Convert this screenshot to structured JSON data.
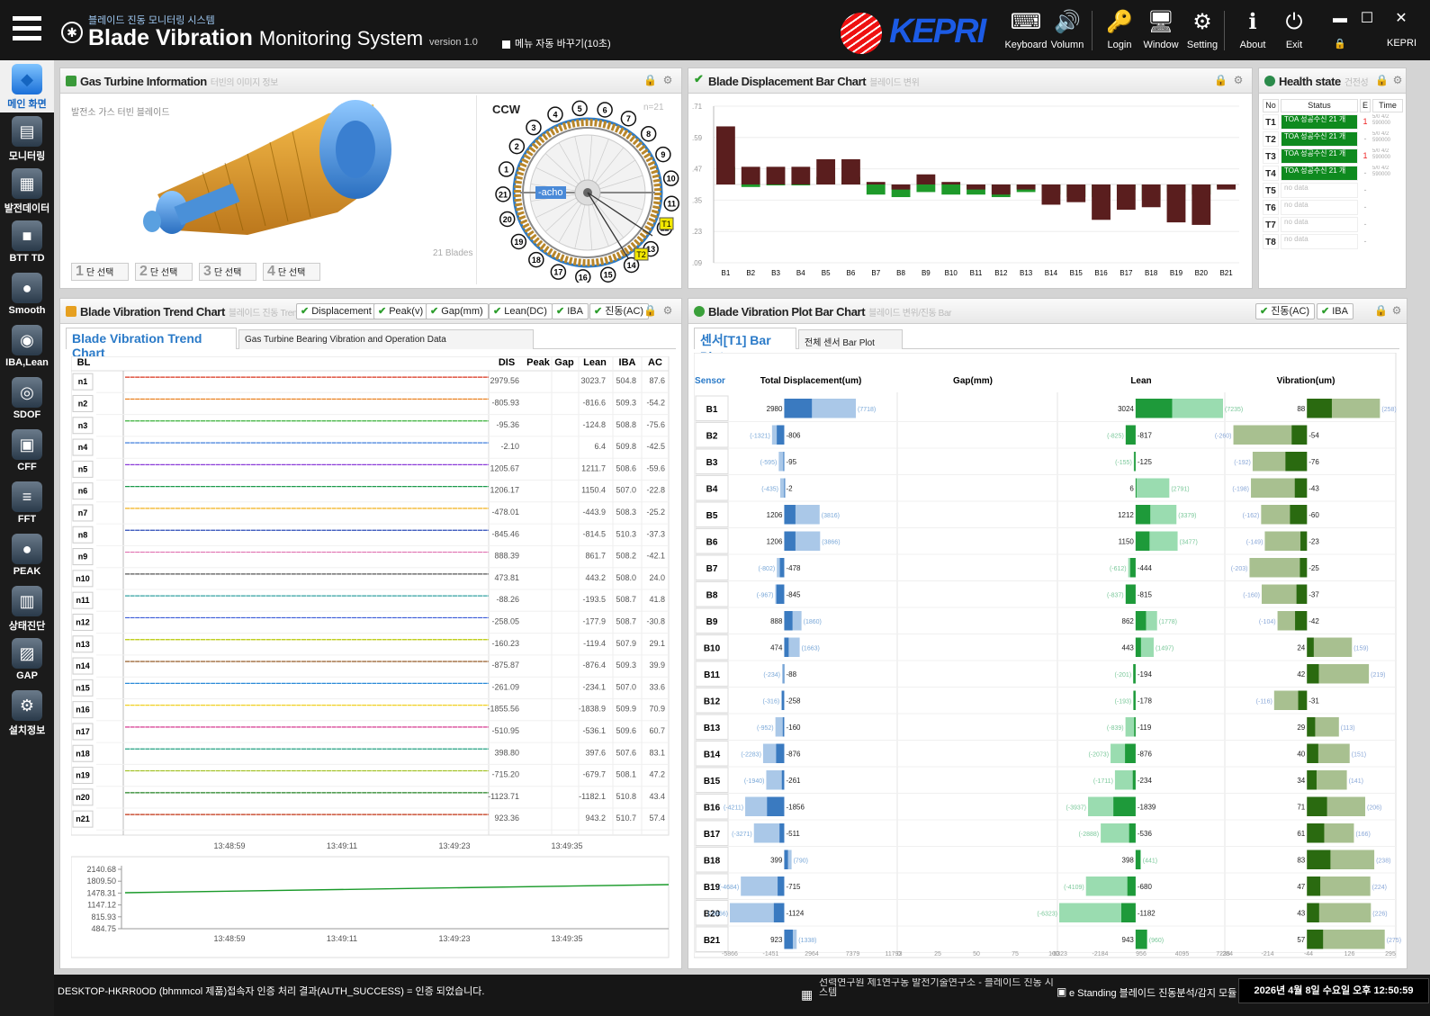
{
  "title": {
    "kr": "블레이드 진동 모니터링 시스템",
    "main": "Blade Vibration",
    "sub": "Monitoring System",
    "version": "version 1.0",
    "auto_menu": "메뉴 자동 바꾸기(10초)",
    "logo": "KEPRI"
  },
  "toolbar": [
    {
      "label": "Keyboard",
      "icon": "keyboard-icon",
      "glyph": "⌨"
    },
    {
      "label": "Volumn",
      "icon": "speaker-icon",
      "glyph": "🔊"
    },
    {
      "label": "Login",
      "icon": "key-icon",
      "glyph": "🔑"
    },
    {
      "label": "Window",
      "icon": "monitor-icon",
      "glyph": "🖥"
    },
    {
      "label": "Setting",
      "icon": "gear-icon",
      "glyph": "⚙"
    },
    {
      "label": "About",
      "icon": "info-icon",
      "glyph": "ℹ"
    },
    {
      "label": "Exit",
      "icon": "power-icon",
      "glyph": "⏻"
    }
  ],
  "user": {
    "name": "KEPRI"
  },
  "sidebar": [
    {
      "label": "메인 화면",
      "icon": "main-screen-icon",
      "glyph": "◆",
      "active": true
    },
    {
      "label": "모니터링",
      "icon": "monitoring-icon",
      "glyph": "▤"
    },
    {
      "label": "발전데이터",
      "icon": "power-data-icon",
      "glyph": "▦"
    },
    {
      "label": "BTT TD",
      "icon": "btt-td-icon",
      "glyph": "■"
    },
    {
      "label": "Smooth",
      "icon": "smooth-icon",
      "glyph": "●"
    },
    {
      "label": "IBA,Lean",
      "icon": "iba-lean-icon",
      "glyph": "◉"
    },
    {
      "label": "SDOF",
      "icon": "sdof-icon",
      "glyph": "◎"
    },
    {
      "label": "CFF",
      "icon": "cff-icon",
      "glyph": "▣"
    },
    {
      "label": "FFT",
      "icon": "fft-icon",
      "glyph": "≡"
    },
    {
      "label": "PEAK",
      "icon": "peak-icon",
      "glyph": "●"
    },
    {
      "label": "상태진단",
      "icon": "diagnosis-icon",
      "glyph": "▥"
    },
    {
      "label": "GAP",
      "icon": "gap-icon",
      "glyph": "▨"
    },
    {
      "label": "설치정보",
      "icon": "install-info-icon",
      "glyph": "⚙"
    }
  ],
  "gas_turbine": {
    "title": "Gas Turbine Information",
    "subtitle": "터빈의 이미지 정보",
    "caption": "발전소 가스 터빈 블레이드",
    "blades_label": "21 Blades",
    "direction": "CCW",
    "n_label": "n=21",
    "tacho": "-acho",
    "stages": [
      {
        "num": "1",
        "label": "단 선택"
      },
      {
        "num": "2",
        "label": "단 선택"
      },
      {
        "num": "3",
        "label": "단 선택"
      },
      {
        "num": "4",
        "label": "단 선택"
      }
    ],
    "sensors": [
      "T1",
      "T2"
    ]
  },
  "bar_chart": {
    "title": "Blade Displacement Bar Chart",
    "subtitle": "블레이드 변위"
  },
  "health": {
    "title": "Health state",
    "subtitle": "건전성",
    "headers": {
      "no": "No",
      "status": "Status",
      "e": "E",
      "time": "Time"
    },
    "rows": [
      {
        "no": "T1",
        "status": "TOA 성공수신 21 개",
        "e": "1",
        "time": "5/0 4/2 590000",
        "ok": true
      },
      {
        "no": "T2",
        "status": "TOA 성공수신 21 개",
        "e": "-",
        "time": "5/0 4/2 590000",
        "ok": true
      },
      {
        "no": "T3",
        "status": "TOA 성공수신 21 개",
        "e": "1",
        "time": "5/0 4/2 590000",
        "ok": true
      },
      {
        "no": "T4",
        "status": "TOA 성공수신 21 개",
        "e": "-",
        "time": "5/0 4/2 590000",
        "ok": true
      },
      {
        "no": "T5",
        "status": "no data",
        "e": "-",
        "time": "",
        "ok": false
      },
      {
        "no": "T6",
        "status": "no data",
        "e": "-",
        "time": "",
        "ok": false
      },
      {
        "no": "T7",
        "status": "no data",
        "e": "-",
        "time": "",
        "ok": false
      },
      {
        "no": "T8",
        "status": "no data",
        "e": "-",
        "time": "",
        "ok": false
      }
    ]
  },
  "trend": {
    "title": "Blade Vibration Trend Chart",
    "subtitle": "블레이드 진동 Trend",
    "chips": [
      "Displacement",
      "Peak(v)",
      "Gap(mm)",
      "Lean(DC)",
      "IBA",
      "진동(AC)"
    ],
    "tab_active": "Blade Vibration Trend Chart",
    "tab_other": "Gas Turbine Bearing Vibration and Operation Data",
    "headers": {
      "bl": "BL",
      "dis": "DIS",
      "peak": "Peak",
      "gap": "Gap",
      "lean": "Lean",
      "iba": "IBA",
      "ac": "AC"
    },
    "x_ticks": [
      "13:48:59",
      "13:49:11",
      "13:49:23",
      "13:49:35"
    ],
    "lower_y_ticks": [
      "2140.68",
      "1809.50",
      "1478.31",
      "1147.12",
      "815.93",
      "484.75"
    ]
  },
  "plot_bar": {
    "title": "Blade Vibration Plot Bar Chart",
    "subtitle": "블레이드 변위/진동 Bar",
    "chips": [
      "진동(AC)",
      "IBA"
    ],
    "tab_active": "센서[T1] Bar Plot",
    "tab_other": "전체 센서 Bar Plot",
    "headers": {
      "sensor": "Sensor",
      "total": "Total Displacement(um)",
      "gap": "Gap(mm)",
      "lean": "Lean",
      "vib": "Vibration(um)"
    },
    "bottom_ticks": {
      "total": [
        "-5866",
        "-1451",
        "2964",
        "7379",
        "11793"
      ],
      "gap": [
        "0",
        "25",
        "50",
        "75",
        "100"
      ],
      "lean": [
        "-6323",
        "-2184",
        "956",
        "4095",
        "7235"
      ],
      "vib": [
        "-284",
        "-214",
        "-44",
        "126",
        "295"
      ]
    }
  },
  "chart_data": {
    "type": "table",
    "blades": [
      {
        "bl": "n1",
        "dis": "2979.56",
        "lean": "3023.7",
        "iba": "504.8",
        "ac": "87.6"
      },
      {
        "bl": "n2",
        "dis": "-805.93",
        "lean": "-816.6",
        "iba": "509.3",
        "ac": "-54.2"
      },
      {
        "bl": "n3",
        "dis": "-95.36",
        "lean": "-124.8",
        "iba": "508.8",
        "ac": "-75.6"
      },
      {
        "bl": "n4",
        "dis": "-2.10",
        "lean": "6.4",
        "iba": "509.8",
        "ac": "-42.5"
      },
      {
        "bl": "n5",
        "dis": "1205.67",
        "lean": "1211.7",
        "iba": "508.6",
        "ac": "-59.6"
      },
      {
        "bl": "n6",
        "dis": "1206.17",
        "lean": "1150.4",
        "iba": "507.0",
        "ac": "-22.8"
      },
      {
        "bl": "n7",
        "dis": "-478.01",
        "lean": "-443.9",
        "iba": "508.3",
        "ac": "-25.2"
      },
      {
        "bl": "n8",
        "dis": "-845.46",
        "lean": "-814.5",
        "iba": "510.3",
        "ac": "-37.3"
      },
      {
        "bl": "n9",
        "dis": "888.39",
        "lean": "861.7",
        "iba": "508.2",
        "ac": "-42.1"
      },
      {
        "bl": "n10",
        "dis": "473.81",
        "lean": "443.2",
        "iba": "508.0",
        "ac": "24.0"
      },
      {
        "bl": "n11",
        "dis": "-88.26",
        "lean": "-193.5",
        "iba": "508.7",
        "ac": "41.8"
      },
      {
        "bl": "n12",
        "dis": "-258.05",
        "lean": "-177.9",
        "iba": "508.7",
        "ac": "-30.8"
      },
      {
        "bl": "n13",
        "dis": "-160.23",
        "lean": "-119.4",
        "iba": "507.9",
        "ac": "29.1"
      },
      {
        "bl": "n14",
        "dis": "-875.87",
        "lean": "-876.4",
        "iba": "509.3",
        "ac": "39.9"
      },
      {
        "bl": "n15",
        "dis": "-261.09",
        "lean": "-234.1",
        "iba": "507.0",
        "ac": "33.6"
      },
      {
        "bl": "n16",
        "dis": "-1855.56",
        "lean": "-1838.9",
        "iba": "509.9",
        "ac": "70.9"
      },
      {
        "bl": "n17",
        "dis": "-510.95",
        "lean": "-536.1",
        "iba": "509.6",
        "ac": "60.7"
      },
      {
        "bl": "n18",
        "dis": "398.80",
        "lean": "397.6",
        "iba": "507.6",
        "ac": "83.1"
      },
      {
        "bl": "n19",
        "dis": "-715.20",
        "lean": "-679.7",
        "iba": "508.1",
        "ac": "47.2"
      },
      {
        "bl": "n20",
        "dis": "-1123.71",
        "lean": "-1182.1",
        "iba": "510.8",
        "ac": "43.4"
      },
      {
        "bl": "n21",
        "dis": "923.36",
        "lean": "943.2",
        "iba": "510.7",
        "ac": "57.4"
      }
    ],
    "bar_chart": {
      "type": "bar",
      "categories": [
        "B1",
        "B2",
        "B3",
        "B4",
        "B5",
        "B6",
        "B7",
        "B8",
        "B9",
        "B10",
        "B11",
        "B12",
        "B13",
        "B14",
        "B15",
        "B16",
        "B17",
        "B18",
        "B19",
        "B20",
        "B21"
      ],
      "y_ticks": [
        ".71",
        ".59",
        ".47",
        ".35",
        ".23",
        ".09"
      ],
      "ylim": [
        0.09,
        0.71
      ],
      "series": [
        {
          "color": "#1e9a2a",
          "values": [
            0.47,
            0.39,
            0.4,
            0.4,
            0.43,
            0.43,
            0.36,
            0.35,
            0.37,
            0.36,
            0.36,
            0.35,
            0.37,
            0.36,
            0.35,
            0.35,
            0.38,
            0.34,
            0.37,
            0.36,
            0.39
          ]
        },
        {
          "color": "#5a1e1e",
          "values": [
            0.63,
            0.47,
            0.47,
            0.47,
            0.5,
            0.5,
            0.41,
            0.38,
            0.44,
            0.41,
            0.38,
            0.36,
            0.38,
            0.32,
            0.33,
            0.26,
            0.3,
            0.31,
            0.25,
            0.24,
            0.38
          ]
        }
      ]
    },
    "bar_plot": {
      "sensors": [
        "B1",
        "B2",
        "B3",
        "B4",
        "B5",
        "B6",
        "B7",
        "B8",
        "B9",
        "B10",
        "B11",
        "B12",
        "B13",
        "B14",
        "B15",
        "B16",
        "B17",
        "B18",
        "B19",
        "B20",
        "B21"
      ],
      "total_value": [
        2980,
        -806,
        -95,
        -2,
        1206,
        1206,
        -478,
        -845,
        888,
        474,
        -88,
        -258,
        -160,
        -876,
        -261,
        -1856,
        -511,
        399,
        -715,
        -1124,
        923
      ],
      "total_label": [
        "2980",
        "-806",
        "-95",
        "-2",
        "1206",
        "1206",
        "-478",
        "-845",
        "888",
        "474",
        "-88",
        "-258",
        "-160",
        "-876",
        "-261",
        "-1856",
        "-511",
        "399",
        "-715",
        "-1124",
        "923"
      ],
      "total_ref": [
        "(7718)",
        "(-1321)",
        "(-595)",
        "(-435)",
        "(3816)",
        "(3866)",
        "(-802)",
        "(-967)",
        "(1860)",
        "(1663)",
        "(-234)",
        "(-316)",
        "(-952)",
        "(-2283)",
        "(-1940)",
        "(-4211)",
        "(-3271)",
        "(790)",
        "(-4684)",
        "(-5866)",
        "(1338)"
      ],
      "total_ref_value": [
        7718,
        -1321,
        -595,
        -435,
        3816,
        3866,
        -802,
        -967,
        1860,
        1663,
        -234,
        -316,
        -952,
        -2283,
        -1940,
        -4211,
        -3271,
        790,
        -4684,
        -5866,
        1338
      ],
      "total_range": [
        -5866,
        11793
      ],
      "lean_value": [
        3024,
        -817,
        -125,
        6,
        1212,
        1150,
        -444,
        -815,
        862,
        443,
        -194,
        -178,
        -119,
        -876,
        -234,
        -1839,
        -536,
        398,
        -680,
        -1182,
        943
      ],
      "lean_label": [
        "3024",
        "-817",
        "-125",
        "6",
        "1212",
        "1150",
        "-444",
        "-815",
        "862",
        "443",
        "-194",
        "-178",
        "-119",
        "-876",
        "-234",
        "-1839",
        "-536",
        "398",
        "-680",
        "-1182",
        "943"
      ],
      "lean_ref": [
        "(7235)",
        "(-825)",
        "(-155)",
        "(2791)",
        "(3379)",
        "(3477)",
        "(-612)",
        "(-837)",
        "(1778)",
        "(1497)",
        "(-201)",
        "(-193)",
        "(-839)",
        "(-2073)",
        "(-1711)",
        "(-3937)",
        "(-2888)",
        "(441)",
        "(-4109)",
        "(-6323)",
        "(960)"
      ],
      "lean_ref_value": [
        7235,
        -825,
        -155,
        2791,
        3379,
        3477,
        -612,
        -837,
        1778,
        1497,
        -201,
        -193,
        -839,
        -2073,
        -1711,
        -3937,
        -2888,
        441,
        -4109,
        -6323,
        960
      ],
      "lean_range": [
        -6323,
        7235
      ],
      "vib_value": [
        88,
        -54,
        -76,
        -43,
        -60,
        -23,
        -25,
        -37,
        -42,
        24,
        42,
        -31,
        29,
        40,
        34,
        71,
        61,
        83,
        47,
        43,
        57
      ],
      "vib_label": [
        "88",
        "-54",
        "-76",
        "-43",
        "-60",
        "-23",
        "-25",
        "-37",
        "-42",
        "24",
        "42",
        "-31",
        "29",
        "40",
        "34",
        "71",
        "61",
        "83",
        "47",
        "43",
        "57"
      ],
      "vib_ref": [
        "(258)",
        "(-260)",
        "(-192)",
        "(-198)",
        "(-162)",
        "(-149)",
        "(-203)",
        "(-160)",
        "(-104)",
        "(159)",
        "(219)",
        "(-116)",
        "(113)",
        "(151)",
        "(141)",
        "(206)",
        "(166)",
        "(238)",
        "(224)",
        "(226)",
        "(275)"
      ],
      "vib_ref_value": [
        258,
        -260,
        -192,
        -198,
        -162,
        -149,
        -203,
        -160,
        -104,
        159,
        219,
        -116,
        113,
        151,
        141,
        206,
        166,
        238,
        224,
        226,
        275
      ],
      "vib_range": [
        -284,
        295
      ]
    }
  },
  "status": {
    "left": "DESKTOP-HKRR0OD (bhmmcol 제품)접속자 인증 처리 결과(AUTH_SUCCESS) = 인증 되었습니다.",
    "mid": "선력연구원 제1연구동 발전기술연구소 - 블레이드 진동 시스템",
    "mid2": "e Standing 블레이드 진동분석/감지 모듈",
    "datetime": "2026년 4월 8일 수요일 오후 12:50:59"
  }
}
